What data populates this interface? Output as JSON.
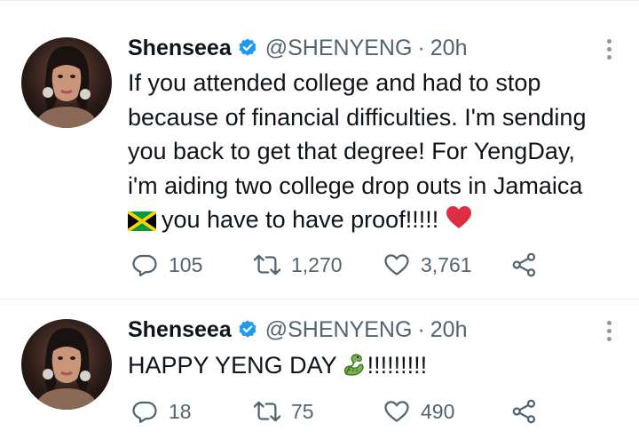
{
  "tweets": [
    {
      "author": {
        "name": "Shenseea",
        "handle": "@SHENYENG",
        "separator": "·",
        "time": "20h"
      },
      "text_lines": [
        "If you attended college and had to stop",
        "because of financial difficulties. I'm sending",
        "you back to get that degree! For YengDay,",
        "i'm aiding two college drop outs in Jamaica",
        "you have to have proof!!!!!"
      ],
      "emojis": [
        "jamaica-flag-icon",
        "red-heart-icon"
      ],
      "counts": {
        "replies": "105",
        "retweets": "1,270",
        "likes": "3,761"
      }
    },
    {
      "author": {
        "name": "Shenseea",
        "handle": "@SHENYENG",
        "separator": "·",
        "time": "20h"
      },
      "text_lines": [
        "HAPPY YENG DAY",
        "!!!!!!!!!"
      ],
      "emojis": [
        "dragon-icon"
      ],
      "counts": {
        "replies": "18",
        "retweets": "75",
        "likes": "490"
      }
    }
  ],
  "colors": {
    "text": "#0f1419",
    "secondary": "#536471",
    "verified": "#1d9bf0",
    "divider": "#e7e9ea",
    "heart": "#e0245e"
  }
}
